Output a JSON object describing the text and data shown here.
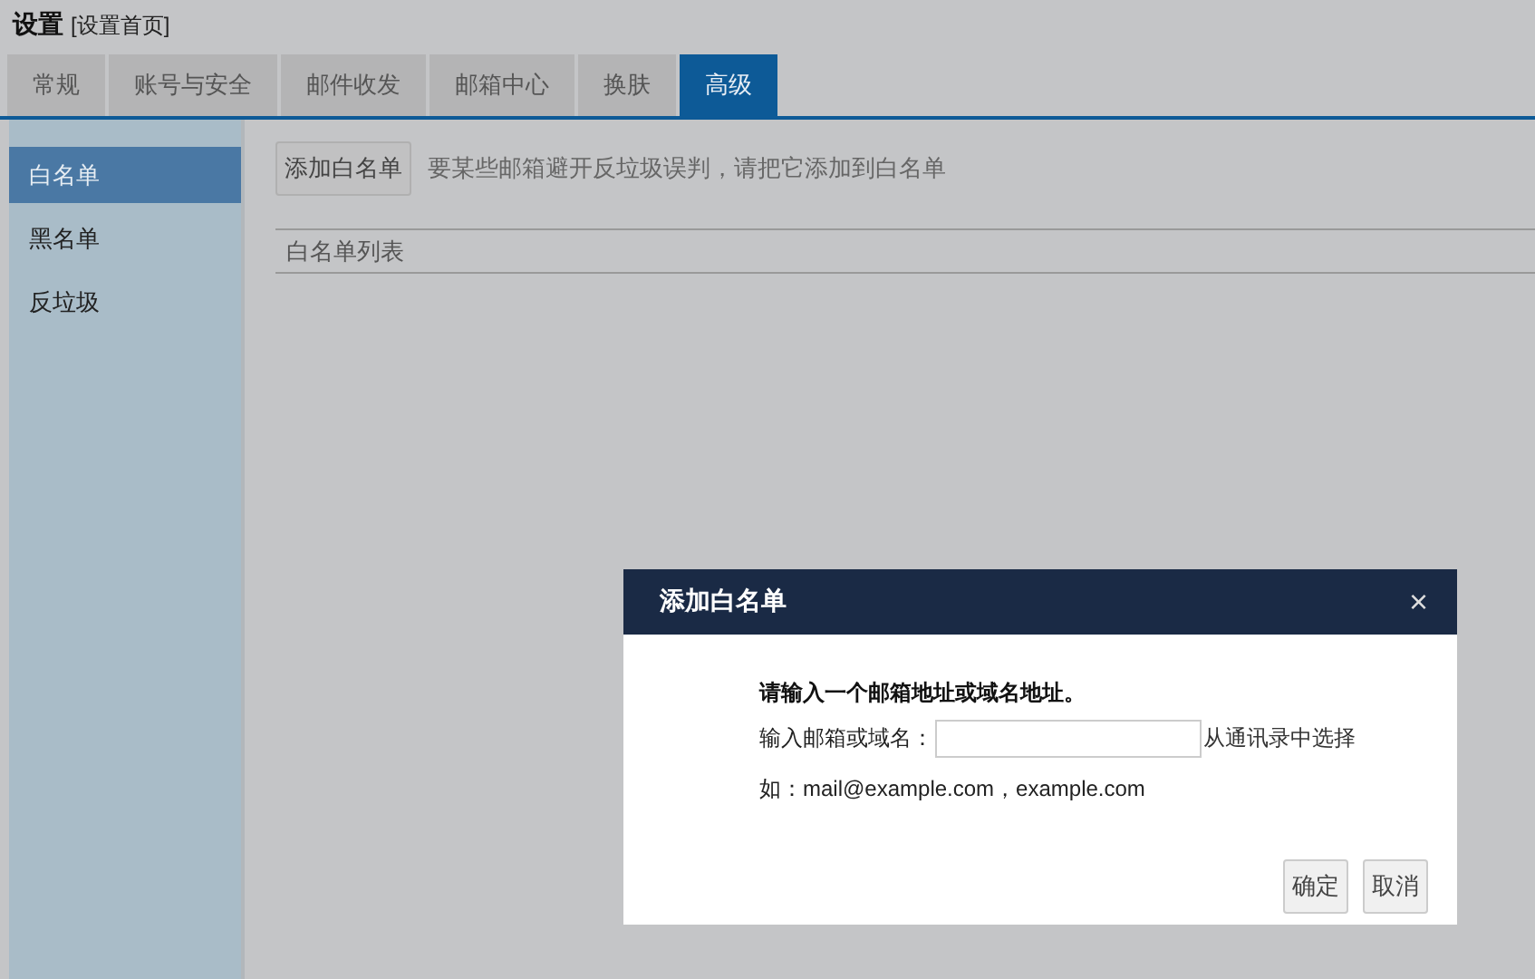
{
  "header": {
    "title": "设置",
    "link": "[设置首页]"
  },
  "tabs": [
    {
      "label": "常规",
      "selected": false
    },
    {
      "label": "账号与安全",
      "selected": false
    },
    {
      "label": "邮件收发",
      "selected": false
    },
    {
      "label": "邮箱中心",
      "selected": false
    },
    {
      "label": "换肤",
      "selected": false
    },
    {
      "label": "高级",
      "selected": true
    }
  ],
  "sidebar": {
    "items": [
      {
        "label": "白名单",
        "selected": true
      },
      {
        "label": "黑名单",
        "selected": false
      },
      {
        "label": "反垃圾",
        "selected": false
      }
    ]
  },
  "content": {
    "add_button": "添加白名单",
    "hint": "要某些邮箱避开反垃圾误判，请把它添加到白名单",
    "list_header": "白名单列表"
  },
  "dialog": {
    "title": "添加白名单",
    "close": "×",
    "prompt": "请输入一个邮箱地址或域名地址。",
    "field_label": "输入邮箱或域名：",
    "contacts_link": "从通讯录中选择",
    "example": "如：mail@example.com，example.com",
    "buttons": [
      "确定",
      "取消"
    ]
  }
}
